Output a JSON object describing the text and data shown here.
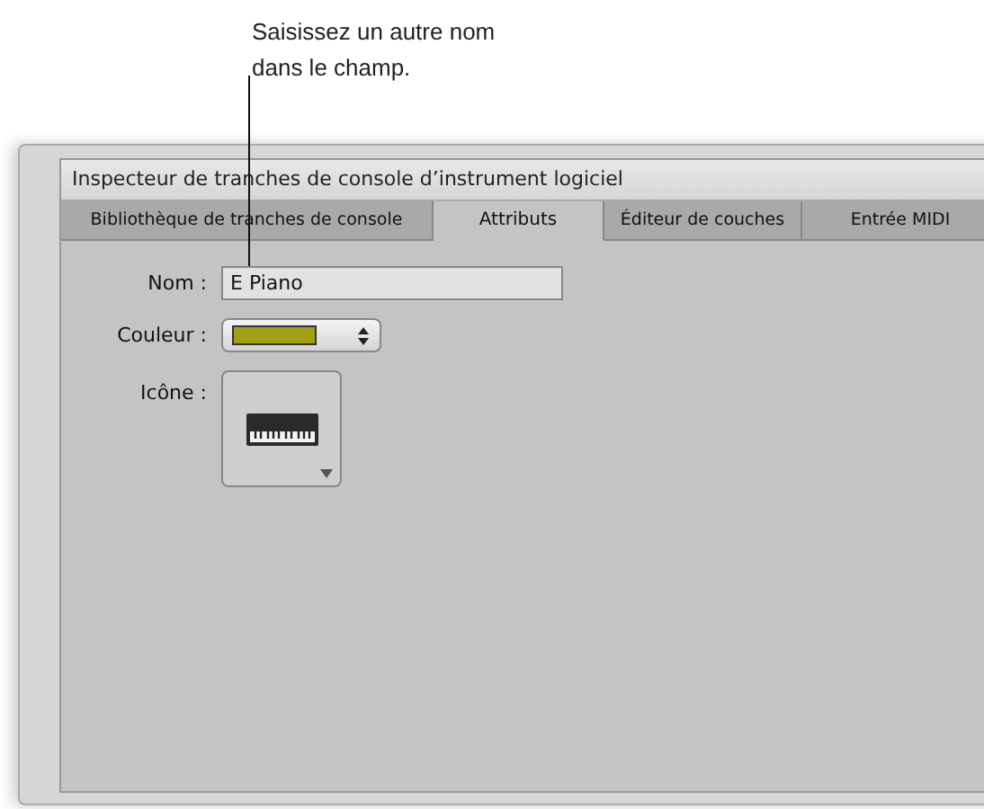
{
  "callout": {
    "text": "Saisissez un autre nom dans le champ."
  },
  "inspector": {
    "title": "Inspecteur de tranches de console d’instrument logiciel",
    "tabs": [
      {
        "label": "Bibliothèque de tranches de console",
        "selected": false
      },
      {
        "label": "Attributs",
        "selected": true
      },
      {
        "label": "Éditeur de couches",
        "selected": false
      },
      {
        "label": "Entrée MIDI",
        "selected": false
      }
    ],
    "name_label": "Nom :",
    "name_value": "E Piano",
    "color_label": "Couleur :",
    "color": "#a0a010",
    "icon_label": "Icône :"
  }
}
